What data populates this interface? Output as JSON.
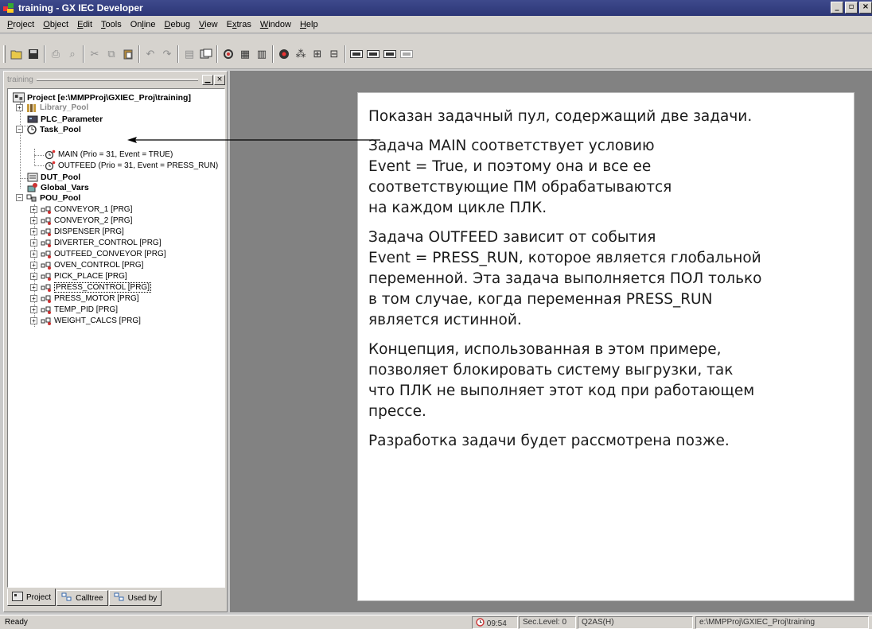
{
  "window": {
    "title": "training - GX IEC Developer"
  },
  "menu": [
    {
      "pre": "",
      "ul": "P",
      "post": "roject"
    },
    {
      "pre": "",
      "ul": "O",
      "post": "bject"
    },
    {
      "pre": "",
      "ul": "E",
      "post": "dit"
    },
    {
      "pre": "",
      "ul": "T",
      "post": "ools"
    },
    {
      "pre": "On",
      "ul": "l",
      "post": "ine"
    },
    {
      "pre": "",
      "ul": "D",
      "post": "ebug"
    },
    {
      "pre": "",
      "ul": "V",
      "post": "iew"
    },
    {
      "pre": "E",
      "ul": "x",
      "post": "tras"
    },
    {
      "pre": "",
      "ul": "W",
      "post": "indow"
    },
    {
      "pre": "",
      "ul": "H",
      "post": "elp"
    }
  ],
  "pane": {
    "title": "training"
  },
  "tree": {
    "project": "Project [e:\\MMPProj\\GXIEC_Proj\\training]",
    "library_pool": "Library_Pool",
    "plc_parameter": "PLC_Parameter",
    "task_pool": "Task_Pool",
    "task_main": "MAIN (Prio = 31, Event = TRUE)",
    "task_outfeed": "OUTFEED (Prio = 31, Event = PRESS_RUN)",
    "dut_pool": "DUT_Pool",
    "global_vars": "Global_Vars",
    "pou_pool": "POU_Pool",
    "pous": [
      "CONVEYOR_1 [PRG]",
      "CONVEYOR_2 [PRG]",
      "DISPENSER [PRG]",
      "DIVERTER_CONTROL [PRG]",
      "OUTFEED_CONVEYOR [PRG]",
      "OVEN_CONTROL [PRG]",
      "PICK_PLACE [PRG]",
      "PRESS_CONTROL [PRG]",
      "PRESS_MOTOR [PRG]",
      "TEMP_PID [PRG]",
      "WEIGHT_CALCS [PRG]"
    ]
  },
  "tabs": [
    "Project",
    "Calltree",
    "Used by"
  ],
  "note": [
    "Показан задачный пул, содержащий две задачи.",
    "Задача MAIN соответствует условию\nEvent = True, и поэтому она и все ее\nсоответствующие ПМ обрабатываются\nна каждом цикле ПЛК.",
    "Задача OUTFEED зависит от события\nEvent = PRESS_RUN, которое является глобальной\nпеременной. Эта задача выполняется ПОЛ только\nв том случае, когда переменная PRESS_RUN\nявляется истинной.",
    "Концепция, использованная в этом примере,\nпозволяет блокировать систему выгрузки, так\nчто ПЛК не выполняет этот код при работающем\nпрессе.",
    "Разработка задачи будет рассмотрена позже."
  ],
  "status": {
    "ready": "Ready",
    "time": "09:54",
    "sec_level": "Sec.Level: 0",
    "cpu": "Q2AS(H)",
    "path": "e:\\MMPProj\\GXIEC_Proj\\training"
  },
  "colors": {
    "title_bar": "#2c3676",
    "workspace": "#828282",
    "face": "#d6d3ce"
  }
}
